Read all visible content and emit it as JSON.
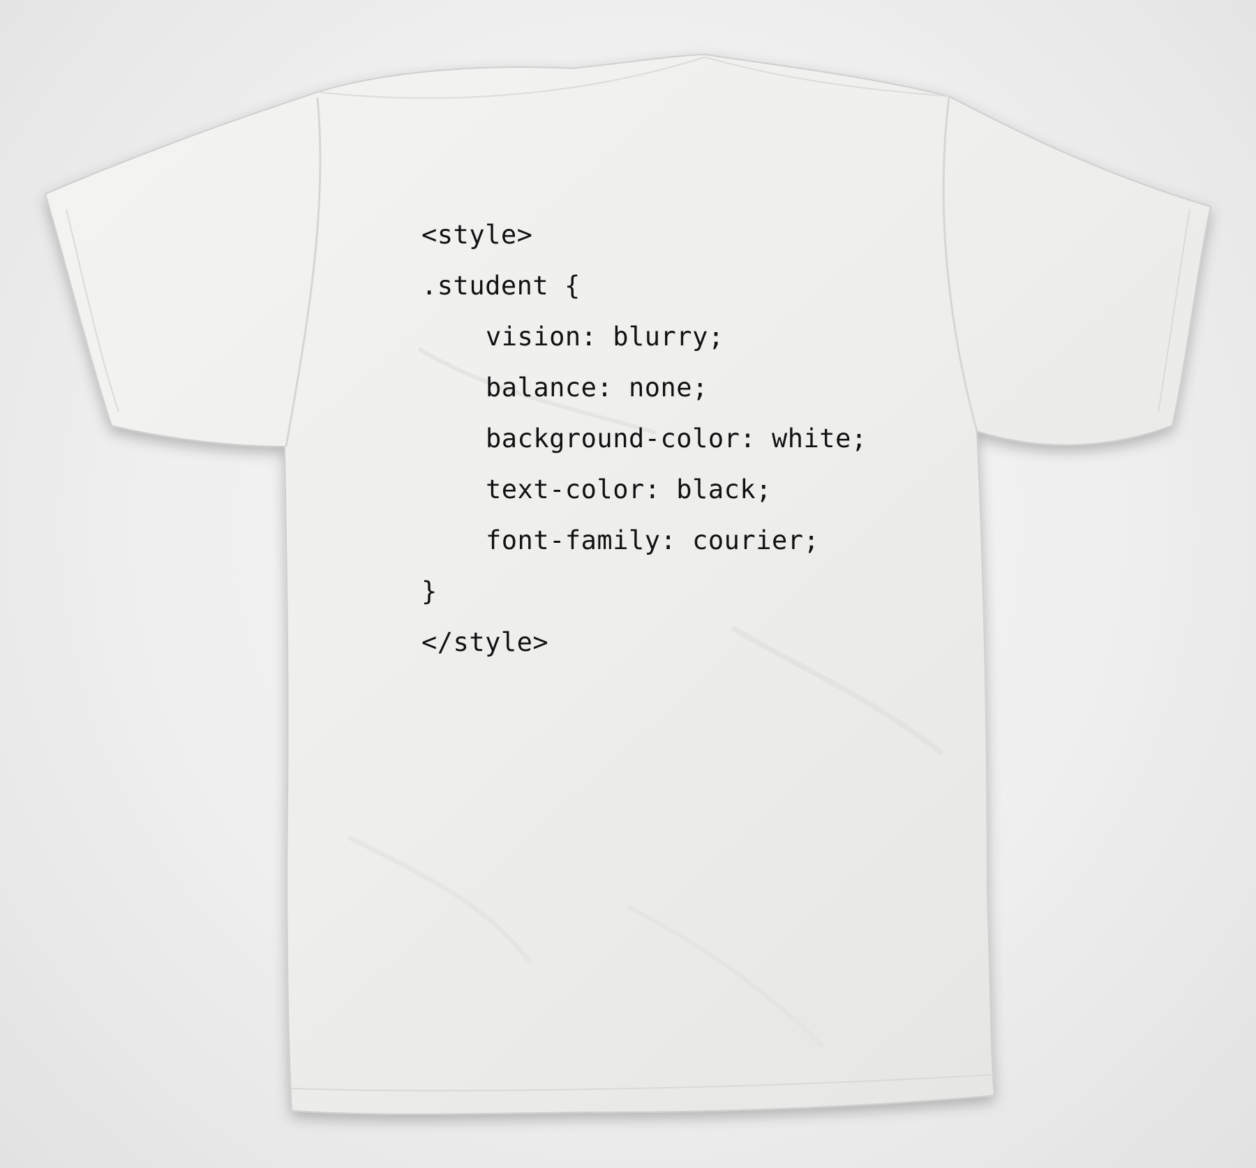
{
  "shirt": {
    "color": "#f0f0ee",
    "print_color": "#111111"
  },
  "code": {
    "open_tag": "<style>",
    "selector": ".student {",
    "declarations": [
      "vision: blurry;",
      "balance: none;",
      "background-color: white;",
      "text-color: black;",
      "font-family: courier;"
    ],
    "close_brace": "}",
    "close_tag": "</style>"
  }
}
